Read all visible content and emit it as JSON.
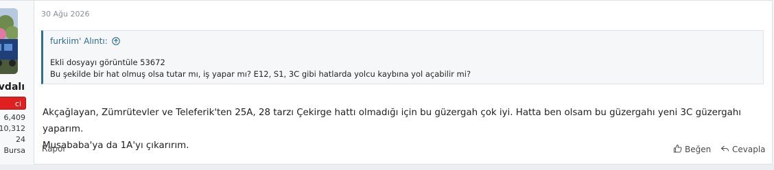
{
  "post": {
    "date": "30 Ağu 2026",
    "user": {
      "name": "evdalı",
      "role": "ci",
      "stats": [
        "6,409",
        "10,312",
        "24",
        "Bursa"
      ]
    },
    "quote": {
      "author": "furkiim' Alıntı:",
      "lines": [
        "Ekli dosyayı görüntüle 53672",
        "Bu şekilde bir hat olmuş olsa tutar mı, iş yapar mı? E12, S1, 3C gibi hatlarda yolcu kaybına yol açabilir mi?"
      ]
    },
    "message_lines": [
      "Akçağlayan, Zümrütevler ve Teleferik'ten 25A, 28 tarzı Çekirge hattı olmadığı için bu güzergah çok iyi. Hatta ben olsam bu güzergahı yeni 3C güzergahı yaparım.",
      "Musababa'ya da 1A'yı çıkarırım."
    ],
    "actions": {
      "report": "Rapor",
      "like": "Beğen",
      "reply": "Cevapla"
    }
  },
  "icons": {
    "quote_jump": "arrow-up-circle-icon",
    "like": "thumbs-up-icon",
    "reply": "reply-icon"
  },
  "colors": {
    "role_badge": "#e02020",
    "quote_accent": "#2f6f8f",
    "quote_text": "#2c6b8c"
  }
}
